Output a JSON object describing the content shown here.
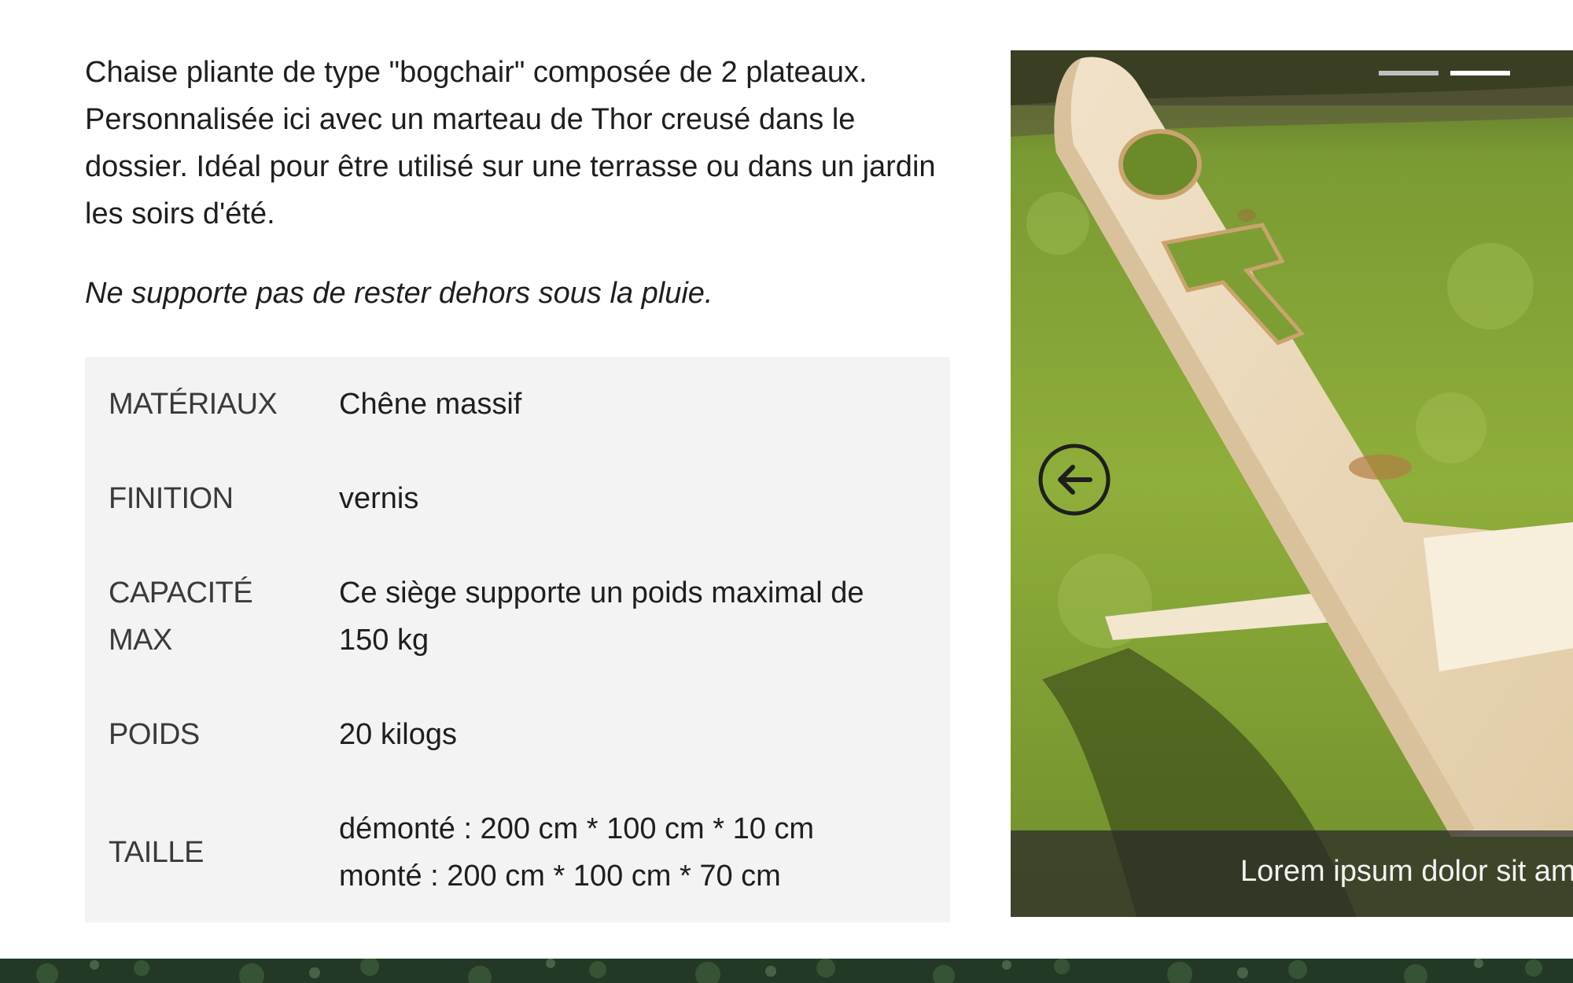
{
  "product": {
    "description": "Chaise pliante de type \"bogchair\" composée de 2 plateaux. Personnalisée ici avec un marteau de Thor creusé dans le dossier. Idéal pour être utilisé sur une terrasse ou dans un jardin les soirs d'été.",
    "note": "Ne supporte pas de rester dehors sous la pluie."
  },
  "specs": {
    "materials": {
      "label": "MATÉRIAUX",
      "value": "Chêne massif"
    },
    "finish": {
      "label": "FINITION",
      "value": "vernis"
    },
    "capacity": {
      "label": "CAPACITÉ MAX",
      "value": "Ce siège supporte un poids maximal de 150 kg"
    },
    "weight": {
      "label": "POIDS",
      "value": "20 kilogs"
    },
    "size": {
      "label": "TAILLE",
      "value_line1": "démonté : 200 cm * 100 cm * 10 cm",
      "value_line2": "monté : 200 cm * 100 cm * 70 cm"
    }
  },
  "carousel": {
    "caption": "Lorem ipsum dolor sit amet",
    "slide_count": 2,
    "active_slide": 2,
    "prev_icon": "arrow-left-circle-icon"
  },
  "colors": {
    "spec_background": "#f3f3f3",
    "text": "#1e1e1e",
    "indicator_active": "#ffffff",
    "indicator_inactive": "#bfbfbf"
  }
}
